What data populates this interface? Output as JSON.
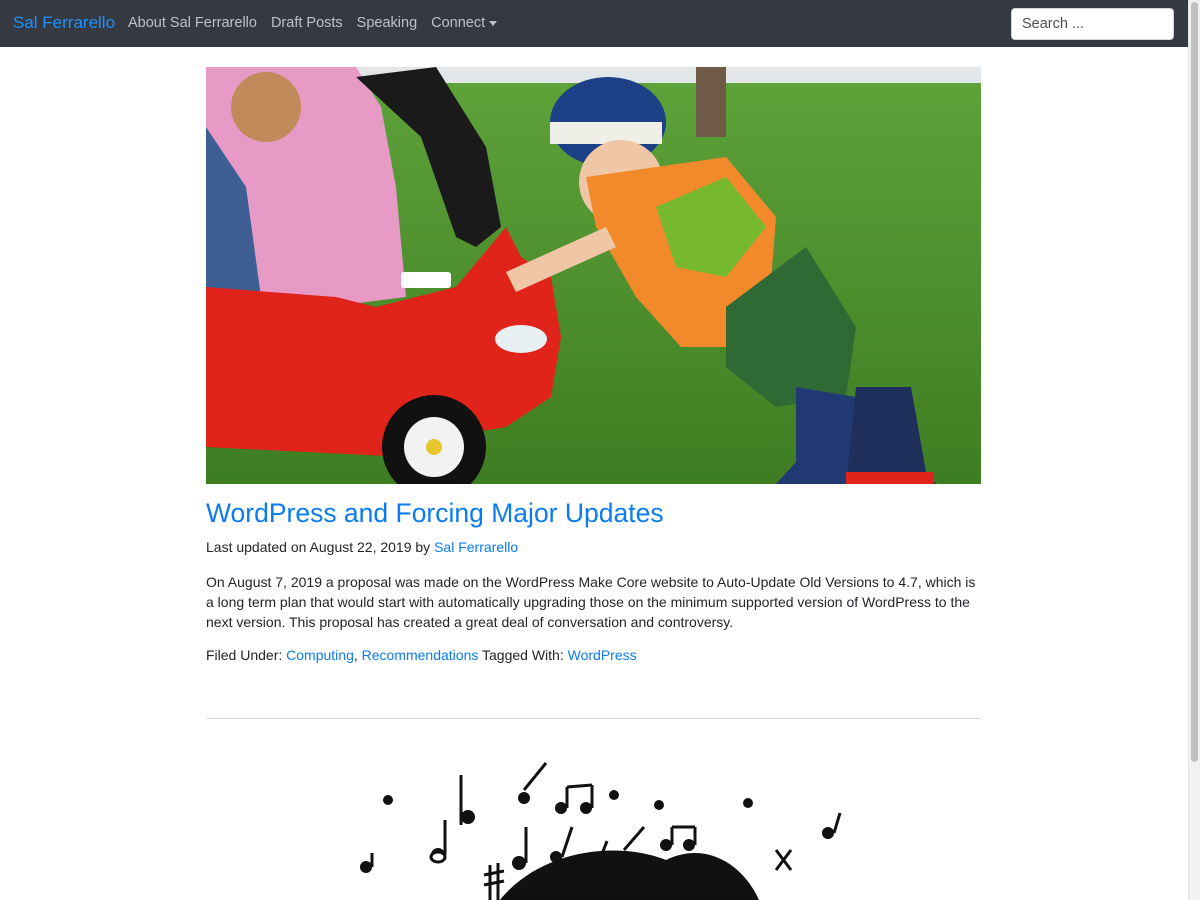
{
  "navbar": {
    "brand": "Sal Ferrarello",
    "items": [
      {
        "label": "About Sal Ferrarello"
      },
      {
        "label": "Draft Posts"
      },
      {
        "label": "Speaking"
      },
      {
        "label": "Connect",
        "dropdown": true
      }
    ],
    "search_placeholder": "Search ..."
  },
  "post": {
    "title": "WordPress and Forcing Major Updates",
    "meta_prefix": "Last updated on August 22, 2019 by",
    "author": "Sal Ferrarello",
    "excerpt": "On August 7, 2019 a proposal was made on the WordPress Make Core website to Auto-Update Old Versions to 4.7, which is a long term plan that would start with automatically upgrading those on the minimum supported version of WordPress to the next version. This proposal has created a great deal of conversation and controversy.",
    "filed_label": "Filed Under:",
    "categories": [
      "Computing",
      "Recommendations"
    ],
    "tagged_label": "Tagged With:",
    "tags": [
      "WordPress"
    ]
  },
  "colors": {
    "navbar_bg": "#343a40",
    "brand": "#1e90ff",
    "link": "#0a7cf0",
    "nav_text": "#bcc2c8"
  },
  "icons": [
    "caret-down-icon"
  ]
}
